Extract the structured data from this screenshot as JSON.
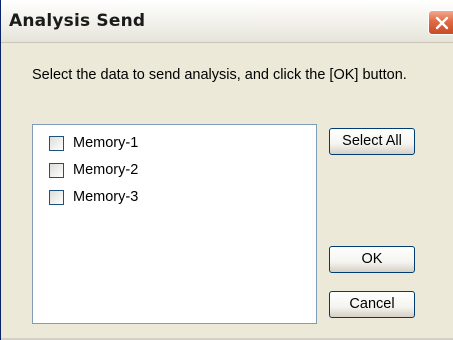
{
  "window": {
    "title": "Analysis Send"
  },
  "instruction": "Select the data to send analysis, and click the [OK] button.",
  "list": {
    "items": [
      {
        "label": "Memory-1",
        "checked": false
      },
      {
        "label": "Memory-2",
        "checked": false
      },
      {
        "label": "Memory-3",
        "checked": false
      }
    ]
  },
  "buttons": {
    "select_all": "Select All",
    "ok": "OK",
    "cancel": "Cancel"
  },
  "icons": {
    "close": "close-icon"
  },
  "colors": {
    "close_button": "#e06a44",
    "window_face": "#ece9d8",
    "list_border": "#7f9db9",
    "button_border": "#003c74"
  }
}
